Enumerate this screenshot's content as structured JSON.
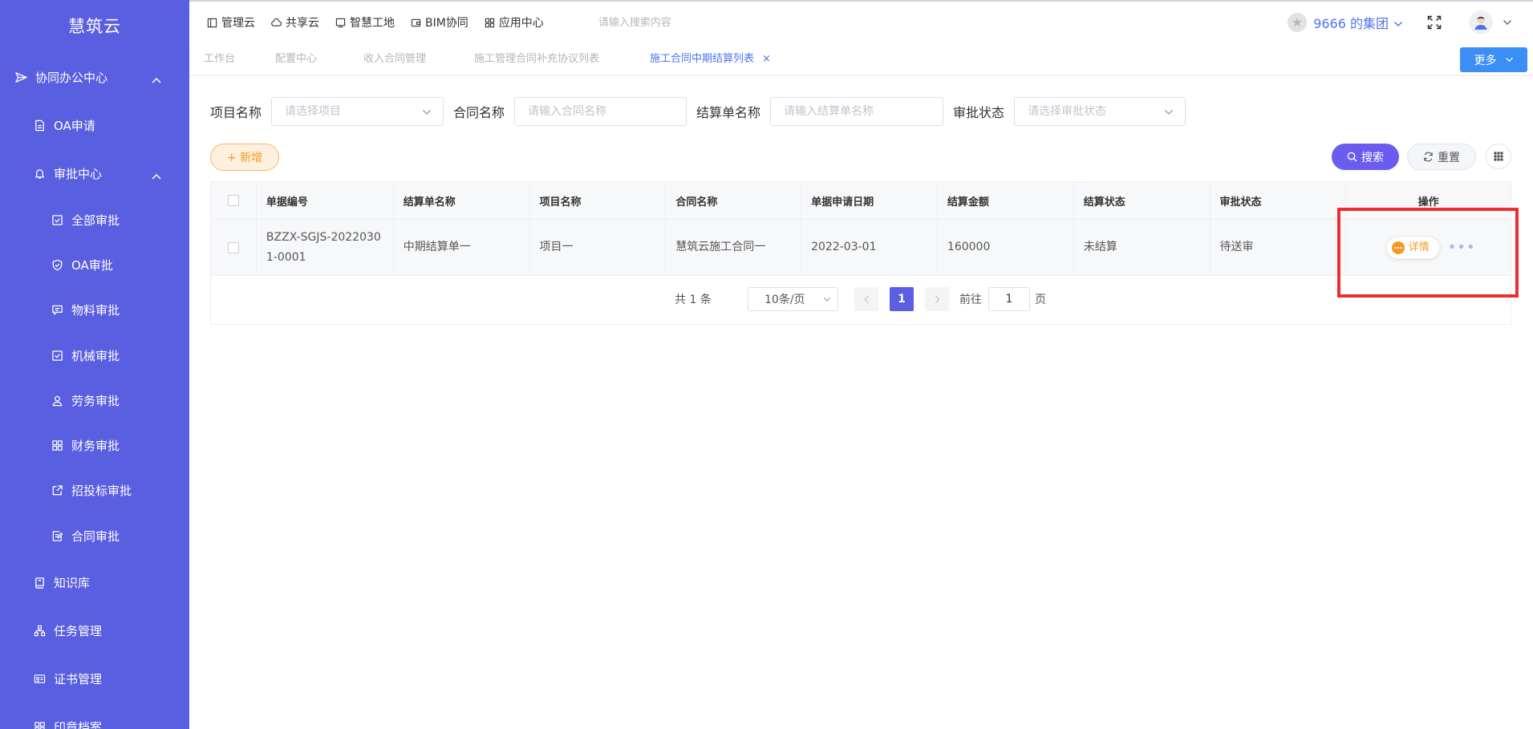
{
  "sidebar": {
    "logo": "慧筑云",
    "items": [
      {
        "label": "协同办公中心",
        "icon": "send-icon"
      },
      {
        "label": "OA申请",
        "icon": "document-icon"
      },
      {
        "label": "审批中心",
        "icon": "bell-icon"
      },
      {
        "label": "全部审批",
        "icon": "checkbox-icon"
      },
      {
        "label": "OA审批",
        "icon": "shield-check-icon"
      },
      {
        "label": "物料审批",
        "icon": "message-icon"
      },
      {
        "label": "机械审批",
        "icon": "checkbox-icon"
      },
      {
        "label": "劳务审批",
        "icon": "user-icon"
      },
      {
        "label": "财务审批",
        "icon": "grid-icon"
      },
      {
        "label": "招投标审批",
        "icon": "external-link-icon"
      },
      {
        "label": "合同审批",
        "icon": "edit-document-icon"
      },
      {
        "label": "知识库",
        "icon": "book-icon"
      },
      {
        "label": "任务管理",
        "icon": "org-chart-icon"
      },
      {
        "label": "证书管理",
        "icon": "id-card-icon"
      },
      {
        "label": "印章档案",
        "icon": "grid-icon"
      }
    ]
  },
  "topbar": {
    "nav": [
      {
        "label": "管理云",
        "icon": "panel-icon"
      },
      {
        "label": "共享云",
        "icon": "cloud-icon"
      },
      {
        "label": "智慧工地",
        "icon": "monitor-icon"
      },
      {
        "label": "BIM协同",
        "icon": "wallet-icon"
      },
      {
        "label": "应用中心",
        "icon": "apps-icon"
      }
    ],
    "search_placeholder": "请输入搜索内容",
    "org_name": "9666 的集团"
  },
  "tabs": [
    {
      "label": "工作台"
    },
    {
      "label": "配置中心"
    },
    {
      "label": "收入合同管理"
    },
    {
      "label": "施工管理合同补充协议列表"
    },
    {
      "label": "施工合同中期结算列表",
      "close": "×"
    }
  ],
  "more_label": "更多",
  "filters": {
    "project_label": "项目名称",
    "project_placeholder": "请选择项目",
    "contract_label": "合同名称",
    "contract_placeholder": "请输入合同名称",
    "settlement_label": "结算单名称",
    "settlement_placeholder": "请输入结算单名称",
    "approval_label": "审批状态",
    "approval_placeholder": "请选择审批状态"
  },
  "actions": {
    "add_label": "+ 新增",
    "search_label": "搜索",
    "reset_label": "重置"
  },
  "table": {
    "headers": [
      "单据编号",
      "结算单名称",
      "项目名称",
      "合同名称",
      "单据申请日期",
      "结算金额",
      "结算状态",
      "审批状态",
      "操作"
    ],
    "rows": [
      {
        "doc_no": "BZZX-SGJS-20220301-0001",
        "settlement_name": "中期结算单一",
        "project_name": "项目一",
        "contract_name": "慧筑云施工合同一",
        "apply_date": "2022-03-01",
        "amount": "160000",
        "settle_status": "未结算",
        "approval_status": "待送审",
        "detail_label": "详情",
        "more_label": "•••"
      }
    ]
  },
  "pagination": {
    "total_text": "共 1 条",
    "page_size": "10条/页",
    "current_page": "1",
    "goto_prefix": "前往",
    "goto_value": "1",
    "goto_suffix": "页"
  },
  "colors": {
    "sidebar": "#5a5ee0",
    "accent": "#4f73f0",
    "orange": "#f39a25",
    "highlight": "#ee2e2e"
  }
}
